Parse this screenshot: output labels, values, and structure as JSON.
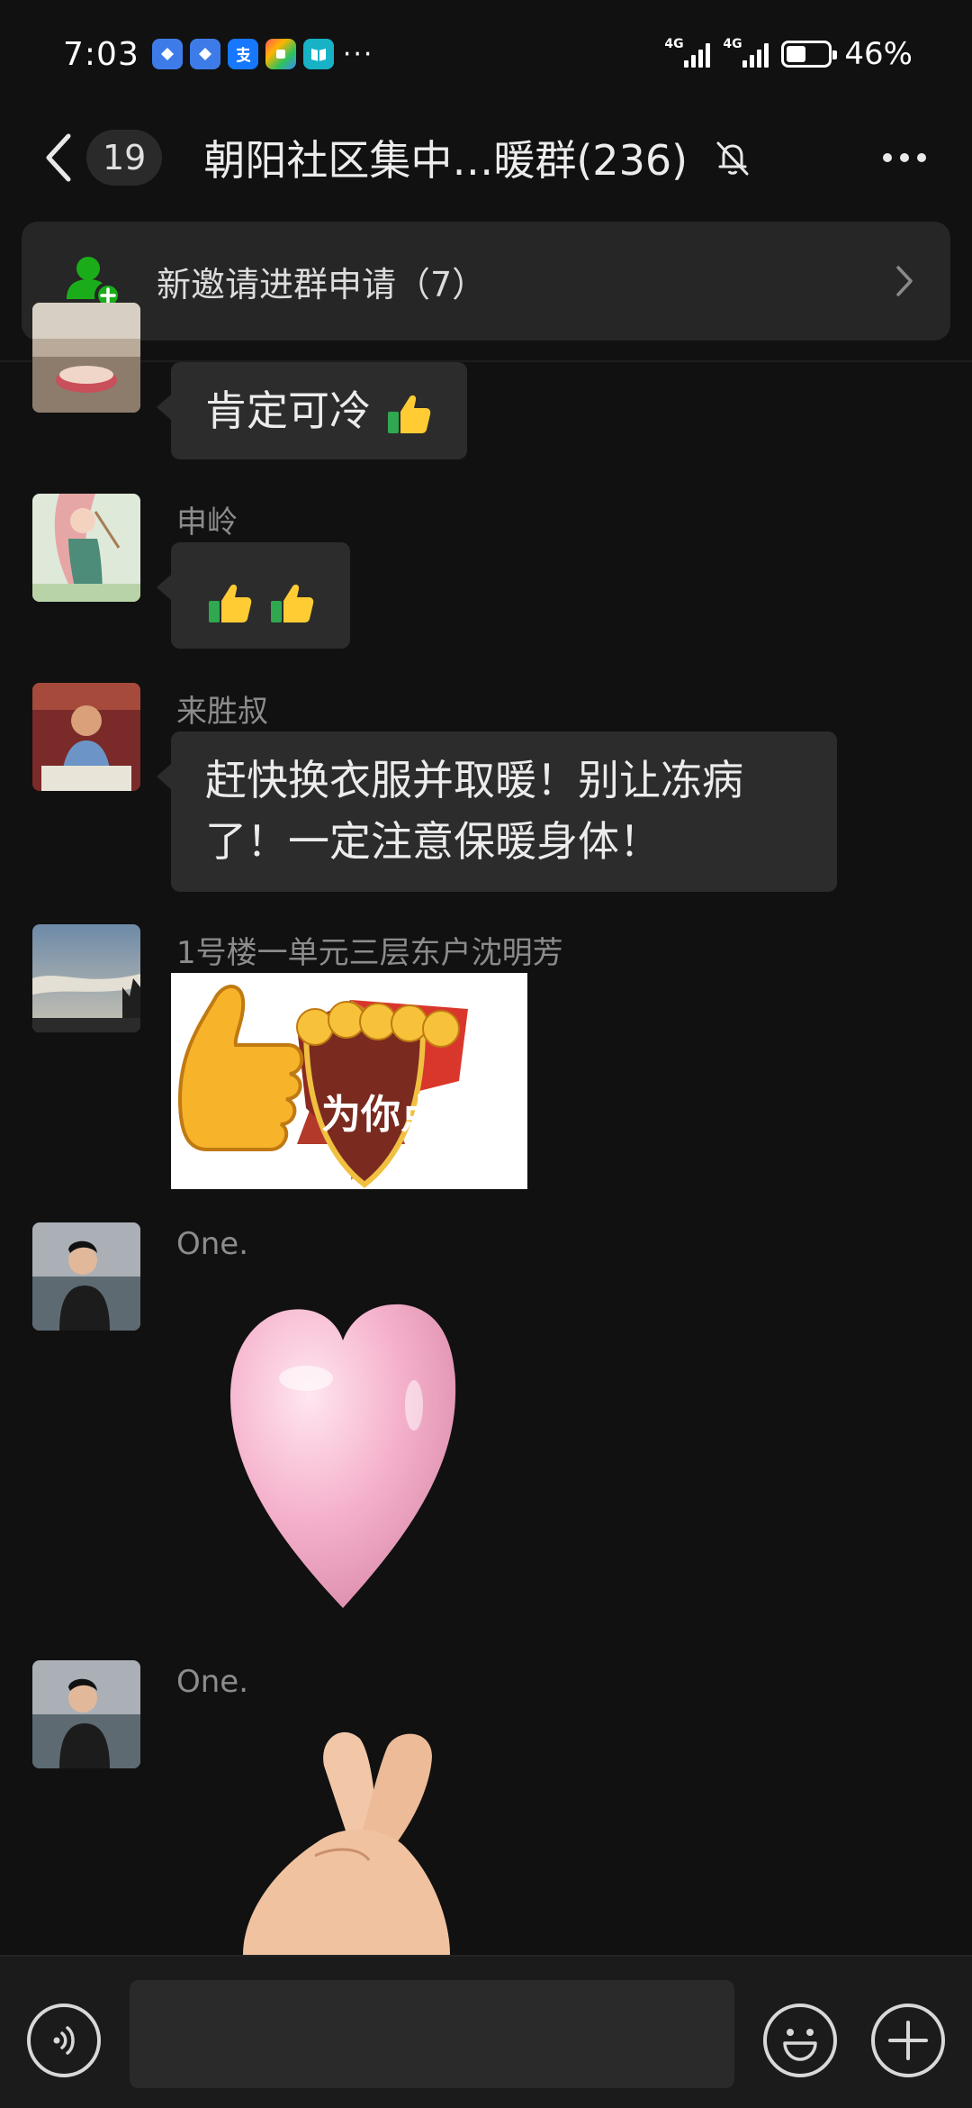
{
  "status_bar": {
    "time": "7:03",
    "more": "···",
    "network_1": "4G",
    "network_2": "4G",
    "battery_percent_text": "46%",
    "battery_level": 0.46,
    "app_icons": [
      "app-icon-blue-1",
      "app-icon-blue-2",
      "alipay-icon",
      "colorful-app-icon",
      "reader-icon"
    ]
  },
  "header": {
    "unread_count": "19",
    "title": "朝阳社区集中…暖群(236)",
    "muted": true
  },
  "invite_banner": {
    "label": "新邀请进群申请（7）",
    "icon": "add-member-icon",
    "accent": "#1aad19"
  },
  "messages": [
    {
      "sender": "",
      "type": "text",
      "text": "肯定可冷",
      "emoji": "thumbs-up"
    },
    {
      "sender": "申岭",
      "type": "emoji",
      "emoji": "thumbs-up x2"
    },
    {
      "sender": "来胜叔",
      "type": "text",
      "text_line1": "赶快换衣服并取暖！别让冻病",
      "text_line2": "了！一定注意保暖身体！"
    },
    {
      "sender": "1号楼一单元三层东户沈明芳",
      "type": "sticker",
      "sticker_text": "为你点赞"
    },
    {
      "sender": "One.",
      "type": "sticker",
      "sticker": "pink-heart"
    },
    {
      "sender": "One.",
      "type": "sticker",
      "sticker": "finger-heart"
    }
  ],
  "input_bar": {
    "placeholder": "",
    "voice_icon": "voice-icon",
    "emoji_icon": "emoji-icon",
    "plus_icon": "plus-icon"
  },
  "colors": {
    "background": "#111111",
    "bubble": "#2c2c2c",
    "name_text": "#8c8c8c"
  }
}
